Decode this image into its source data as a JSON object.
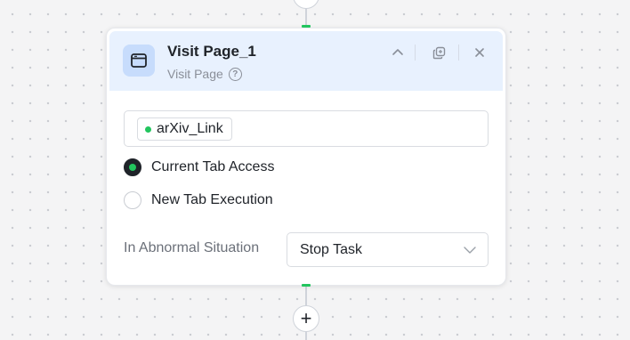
{
  "node": {
    "title": "Visit Page_1",
    "subtitle": "Visit Page",
    "icon": "browser-window-icon",
    "header_bg": "#e8f1fe"
  },
  "url_field": {
    "tag_label": "arXiv_Link",
    "tag_dot_color": "#22c55e"
  },
  "tab_mode": {
    "options": [
      {
        "label": "Current Tab Access",
        "checked": true
      },
      {
        "label": "New Tab Execution",
        "checked": false
      }
    ]
  },
  "abnormal": {
    "label": "In Abnormal Situation",
    "selected": "Stop Task"
  },
  "colors": {
    "accent_green": "#22c55e",
    "text_primary": "#1f2329",
    "text_muted": "#8a8f99"
  },
  "icons": {
    "collapse": "chevron-up-icon",
    "copy": "copy-icon",
    "close": "close-icon",
    "help": "help-icon",
    "dropdown": "chevron-down-icon",
    "add": "plus-icon"
  },
  "add_button": {
    "label": "+"
  }
}
